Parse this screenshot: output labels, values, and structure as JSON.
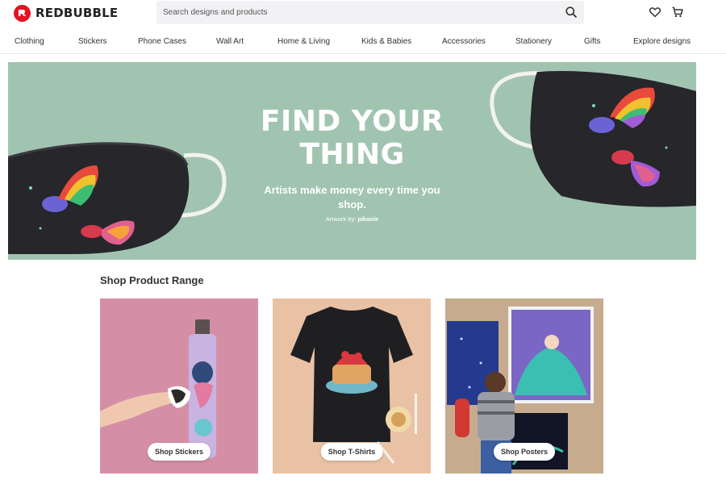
{
  "header": {
    "brand": "REDBUBBLE",
    "search": {
      "placeholder": "Search designs and products"
    },
    "icons": {
      "search": "search-icon",
      "wishlist": "heart-icon",
      "cart": "cart-icon"
    }
  },
  "nav": {
    "items": [
      "Clothing",
      "Stickers",
      "Phone Cases",
      "Wall Art",
      "Home & Living",
      "Kids & Babies",
      "Accessories",
      "Stationery",
      "Gifts",
      "Explore designs"
    ]
  },
  "hero": {
    "title_line1": "FIND YOUR",
    "title_line2": "THING",
    "subtitle": "Artists make money every time you shop.",
    "credit_prefix": "Artwork by:",
    "credit_artist": "pikaole"
  },
  "products": {
    "section_title": "Shop Product Range",
    "cards": [
      {
        "label": "Shop Stickers"
      },
      {
        "label": "Shop T-Shirts"
      },
      {
        "label": "Shop Posters"
      }
    ]
  },
  "colors": {
    "brand": "#e41321",
    "hero_bg": "#a1c4b1",
    "card_stickers": "#d48fa6",
    "card_tshirts": "#e9c2a6",
    "card_posters": "#c7ab8f"
  }
}
